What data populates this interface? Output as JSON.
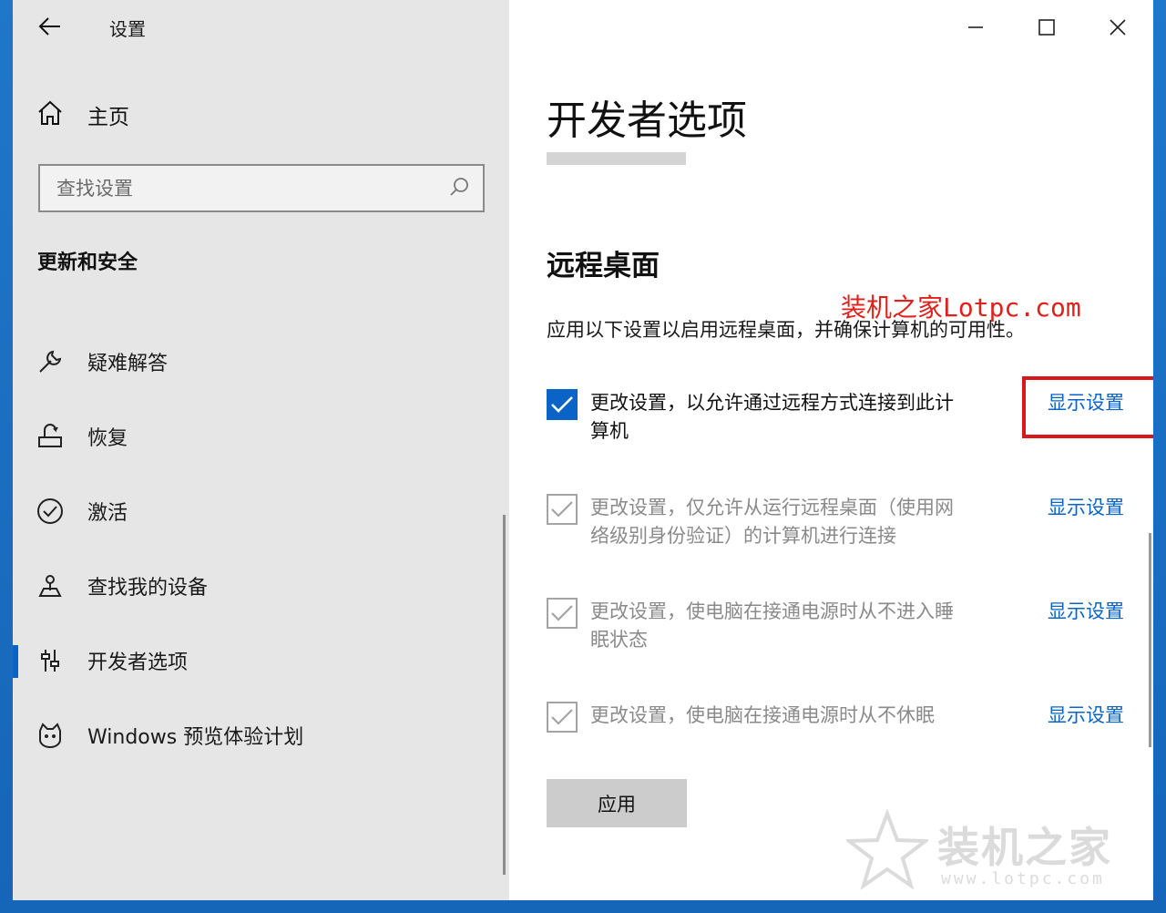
{
  "window": {
    "title": "设置",
    "controls": [
      "minimize-icon",
      "maximize-icon",
      "close-icon"
    ]
  },
  "sidebar": {
    "home_label": "主页",
    "search_placeholder": "查找设置",
    "section_heading": "更新和安全",
    "items": [
      {
        "label": "疑难解答",
        "icon": "wrench-icon",
        "selected": false
      },
      {
        "label": "恢复",
        "icon": "recovery-icon",
        "selected": false
      },
      {
        "label": "激活",
        "icon": "activation-check-icon",
        "selected": false
      },
      {
        "label": "查找我的设备",
        "icon": "find-device-icon",
        "selected": false
      },
      {
        "label": "开发者选项",
        "icon": "developer-sliders-icon",
        "selected": true
      },
      {
        "label": "Windows 预览体验计划",
        "icon": "insider-cat-icon",
        "selected": false
      }
    ]
  },
  "main": {
    "page_title": "开发者选项",
    "section_title": "远程桌面",
    "watermark_text": "装机之家Lotpc.com",
    "description": "应用以下设置以启用远程桌面，并确保计算机的可用性。",
    "options": [
      {
        "line1": "更改设置，以允许通过远程方式连接到此计",
        "line2": "算机",
        "checked": true,
        "enabled": true,
        "link": "显示设置"
      },
      {
        "line1": "更改设置，仅允许从运行远程桌面（使用网",
        "line2": "络级别身份验证）的计算机进行连接",
        "checked": true,
        "enabled": false,
        "link": "显示设置"
      },
      {
        "line1": "更改设置，使电脑在接通电源时从不进入睡",
        "line2": "眠状态",
        "checked": true,
        "enabled": false,
        "link": "显示设置"
      },
      {
        "line1": "更改设置，使电脑在接通电源时从不休眠",
        "line2": "",
        "checked": true,
        "enabled": false,
        "link": "显示设置"
      }
    ],
    "apply_label": "应用",
    "logo_watermark": {
      "title": "装机之家",
      "url": "www.lotpc.com"
    }
  },
  "colors": {
    "accent": "#0a64c8",
    "highlight": "#d9161c",
    "sidebar_bg": "#e6e6e6"
  }
}
